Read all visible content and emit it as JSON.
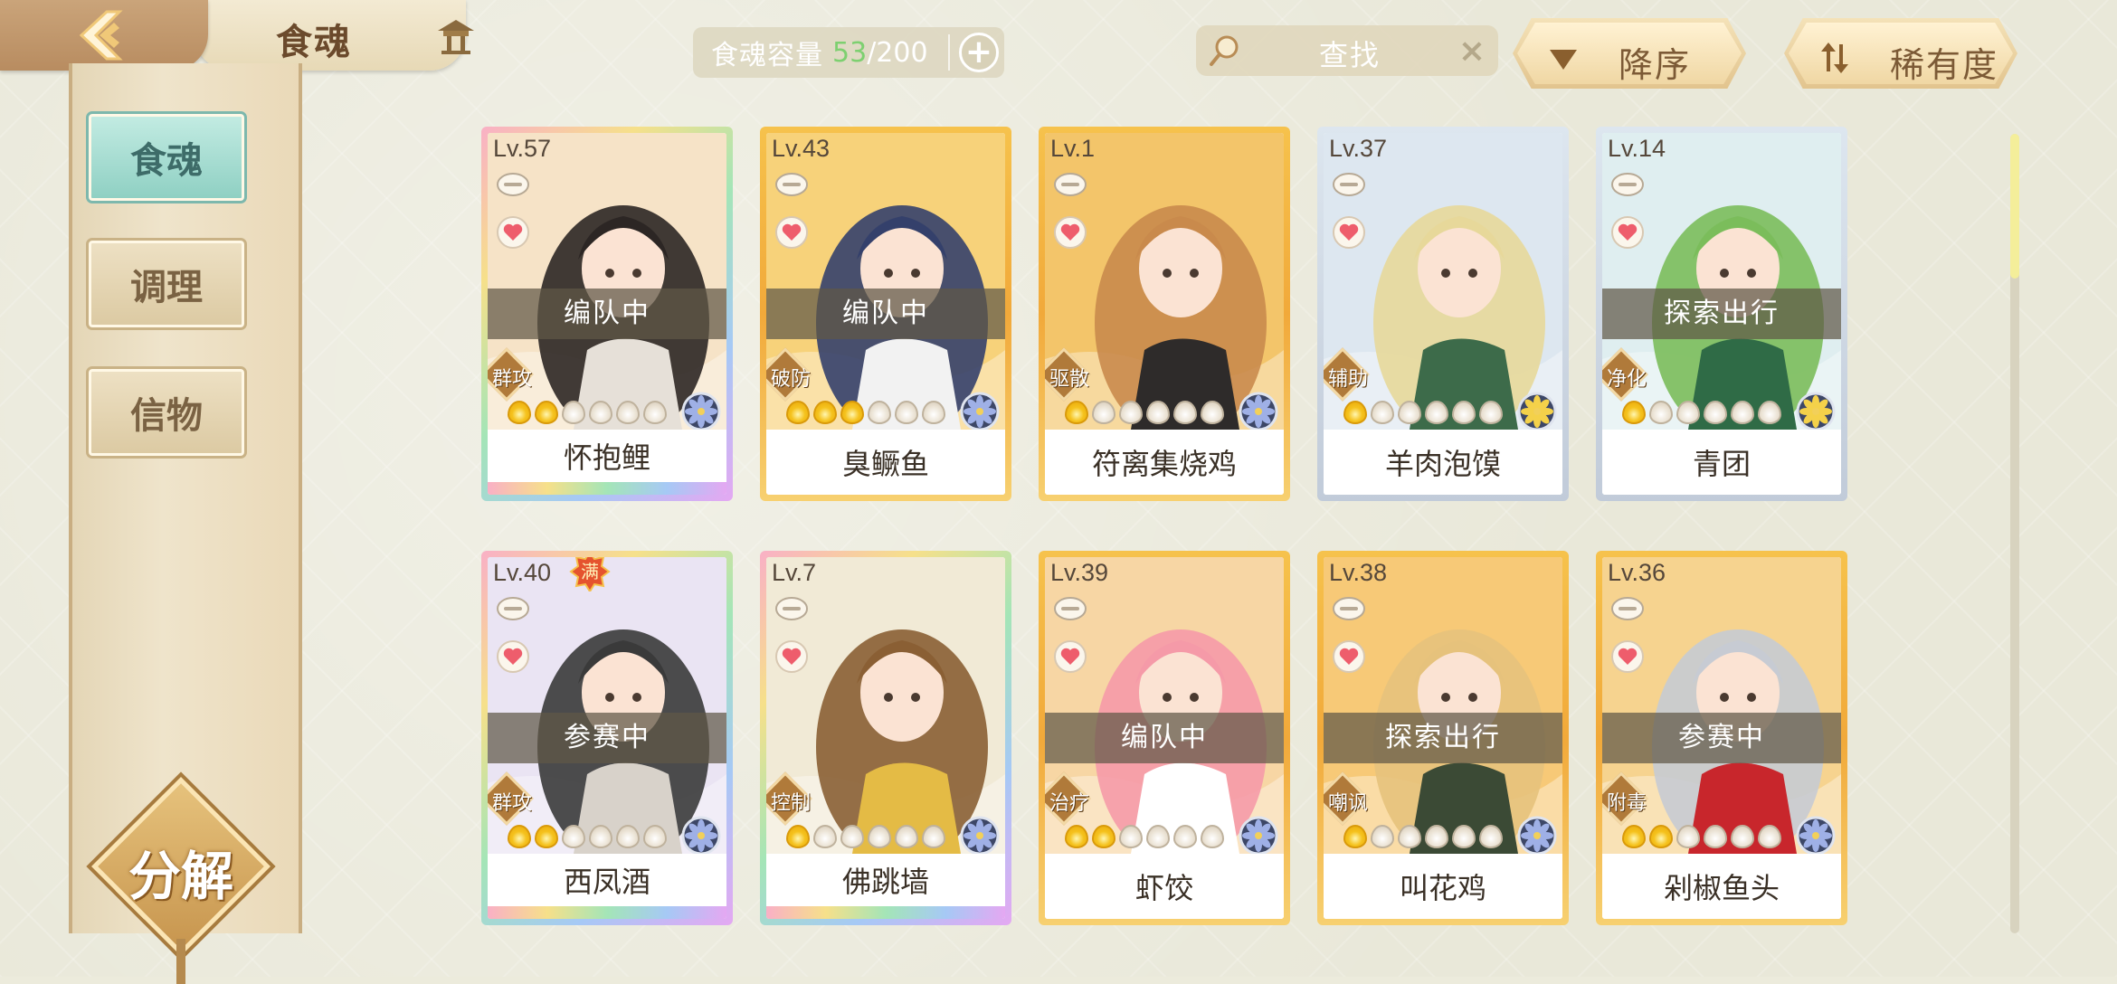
{
  "header": {
    "title": "食魂",
    "capacity": {
      "label": "食魂容量",
      "used": "53",
      "separator": "/",
      "total": "200"
    },
    "search": {
      "placeholder": "查找"
    },
    "sort_label": "降序",
    "filter_label": "稀有度"
  },
  "sidebar": {
    "tabs": [
      {
        "label": "食魂",
        "active": true
      },
      {
        "label": "调理",
        "active": false
      },
      {
        "label": "信物",
        "active": false
      }
    ],
    "decompose_label": "分解"
  },
  "colors": {
    "accent_teal": "#8fd0c3",
    "star_gold": "#f5c21d",
    "capacity_green": "#7dd070",
    "frame_gold": "#f1a93a"
  },
  "cards": [
    {
      "level": "Lv.57",
      "name": "怀抱鲤",
      "status": "编队中",
      "role": "群攻",
      "stars_on": 2,
      "max": false,
      "frame": "rainbow"
    },
    {
      "level": "Lv.43",
      "name": "臭鳜鱼",
      "status": "编队中",
      "role": "破防",
      "stars_on": 3,
      "max": false,
      "frame": "gold"
    },
    {
      "level": "Lv.1",
      "name": "符离集烧鸡",
      "status": "",
      "role": "驱散",
      "stars_on": 1,
      "max": false,
      "frame": "gold"
    },
    {
      "level": "Lv.37",
      "name": "羊肉泡馍",
      "status": "",
      "role": "辅助",
      "stars_on": 1,
      "max": false,
      "frame": "silver"
    },
    {
      "level": "Lv.14",
      "name": "青团",
      "status": "探索出行",
      "role": "净化",
      "stars_on": 1,
      "max": false,
      "frame": "silver"
    },
    {
      "level": "Lv.40",
      "name": "西凤酒",
      "status": "参赛中",
      "role": "群攻",
      "stars_on": 2,
      "max": true,
      "max_label": "满",
      "frame": "rainbow"
    },
    {
      "level": "Lv.7",
      "name": "佛跳墙",
      "status": "",
      "role": "控制",
      "stars_on": 1,
      "max": false,
      "frame": "rainbow"
    },
    {
      "level": "Lv.39",
      "name": "虾饺",
      "status": "编队中",
      "role": "治疗",
      "stars_on": 2,
      "max": false,
      "frame": "gold"
    },
    {
      "level": "Lv.38",
      "name": "叫花鸡",
      "status": "探索出行",
      "role": "嘲讽",
      "stars_on": 1,
      "max": false,
      "frame": "gold"
    },
    {
      "level": "Lv.36",
      "name": "剁椒鱼头",
      "status": "参赛中",
      "role": "附毒",
      "stars_on": 2,
      "max": false,
      "frame": "gold"
    }
  ]
}
